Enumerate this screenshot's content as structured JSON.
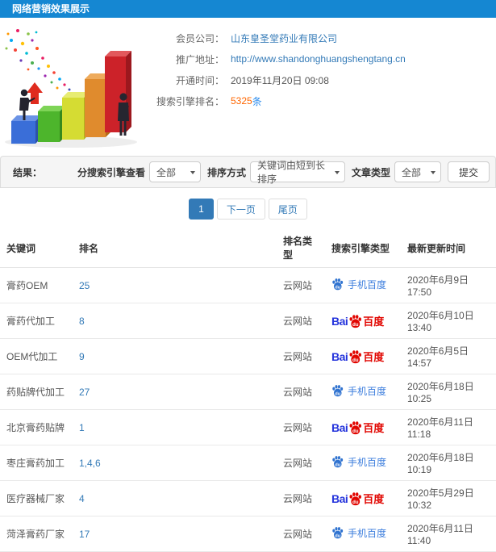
{
  "header": {
    "title": "网络营销效果展示"
  },
  "illustration": {
    "name": "growth-bar-chart-illustration"
  },
  "info": {
    "fields": [
      {
        "label": "会员公司：",
        "value": "山东皇圣堂药业有限公司"
      },
      {
        "label": "推广地址：",
        "value": "http://www.shandonghuangshengtang.cn"
      },
      {
        "label": "开通时间：",
        "value": "2019年11月20日 09:08"
      },
      {
        "label": "搜索引擎排名：",
        "value": "5325",
        "suffix": "条"
      }
    ]
  },
  "filters": {
    "result_label": "结果：",
    "engine_label": "分搜索引擎查看",
    "engine_value": "全部",
    "sort_label": "排序方式",
    "sort_value": "关键词由短到长排序",
    "article_label": "文章类型",
    "article_value": "全部",
    "submit_label": "提交"
  },
  "pagination": {
    "current": "1",
    "next": "下一页",
    "last": "尾页"
  },
  "engines": {
    "baidu": {
      "prefix": "Bai",
      "du": "du",
      "suffix": "百度"
    },
    "mobile": {
      "du": "du",
      "label": "手机百度"
    }
  },
  "table": {
    "headers": [
      "关键词",
      "排名",
      "排名类型",
      "搜索引擎类型",
      "最新更新时间"
    ],
    "rows": [
      {
        "keyword": "膏药OEM",
        "rank": "25",
        "rank_type": "云网站",
        "engine": "mobile",
        "updated": "2020年6月9日 17:50"
      },
      {
        "keyword": "膏药代加工",
        "rank": "8",
        "rank_type": "云网站",
        "engine": "baidu",
        "updated": "2020年6月10日 13:40"
      },
      {
        "keyword": "OEM代加工",
        "rank": "9",
        "rank_type": "云网站",
        "engine": "baidu",
        "updated": "2020年6月5日 14:57"
      },
      {
        "keyword": "药贴牌代加工",
        "rank": "27",
        "rank_type": "云网站",
        "engine": "mobile",
        "updated": "2020年6月18日 10:25"
      },
      {
        "keyword": "北京膏药贴牌",
        "rank": "1",
        "rank_type": "云网站",
        "engine": "baidu",
        "updated": "2020年6月11日 11:18"
      },
      {
        "keyword": "枣庄膏药加工",
        "rank": "1,4,6",
        "rank_type": "云网站",
        "engine": "mobile",
        "updated": "2020年6月18日 10:19"
      },
      {
        "keyword": "医疗器械厂家",
        "rank": "4",
        "rank_type": "云网站",
        "engine": "baidu",
        "updated": "2020年5月29日 10:32"
      },
      {
        "keyword": "菏泽膏药厂家",
        "rank": "17",
        "rank_type": "云网站",
        "engine": "mobile",
        "updated": "2020年6月11日 11:40"
      }
    ]
  },
  "icons": {
    "dropdown_caret": "chevron-down",
    "baidu_paw": "baidu-paw",
    "mobile_baidu_paw": "baidu-paw"
  },
  "colors": {
    "header_bg": "#1587d2",
    "link_blue": "#337ab7",
    "rank_orange": "#ff6600",
    "rank_suffix_blue": "#2e8ded",
    "baidu_red": "#e10601",
    "baidu_blue": "#2534dc",
    "mobile_baidu_blue": "#3073d0",
    "filter_bar_bg": "#f5f5f5",
    "active_page_bg": "#337ab7"
  }
}
